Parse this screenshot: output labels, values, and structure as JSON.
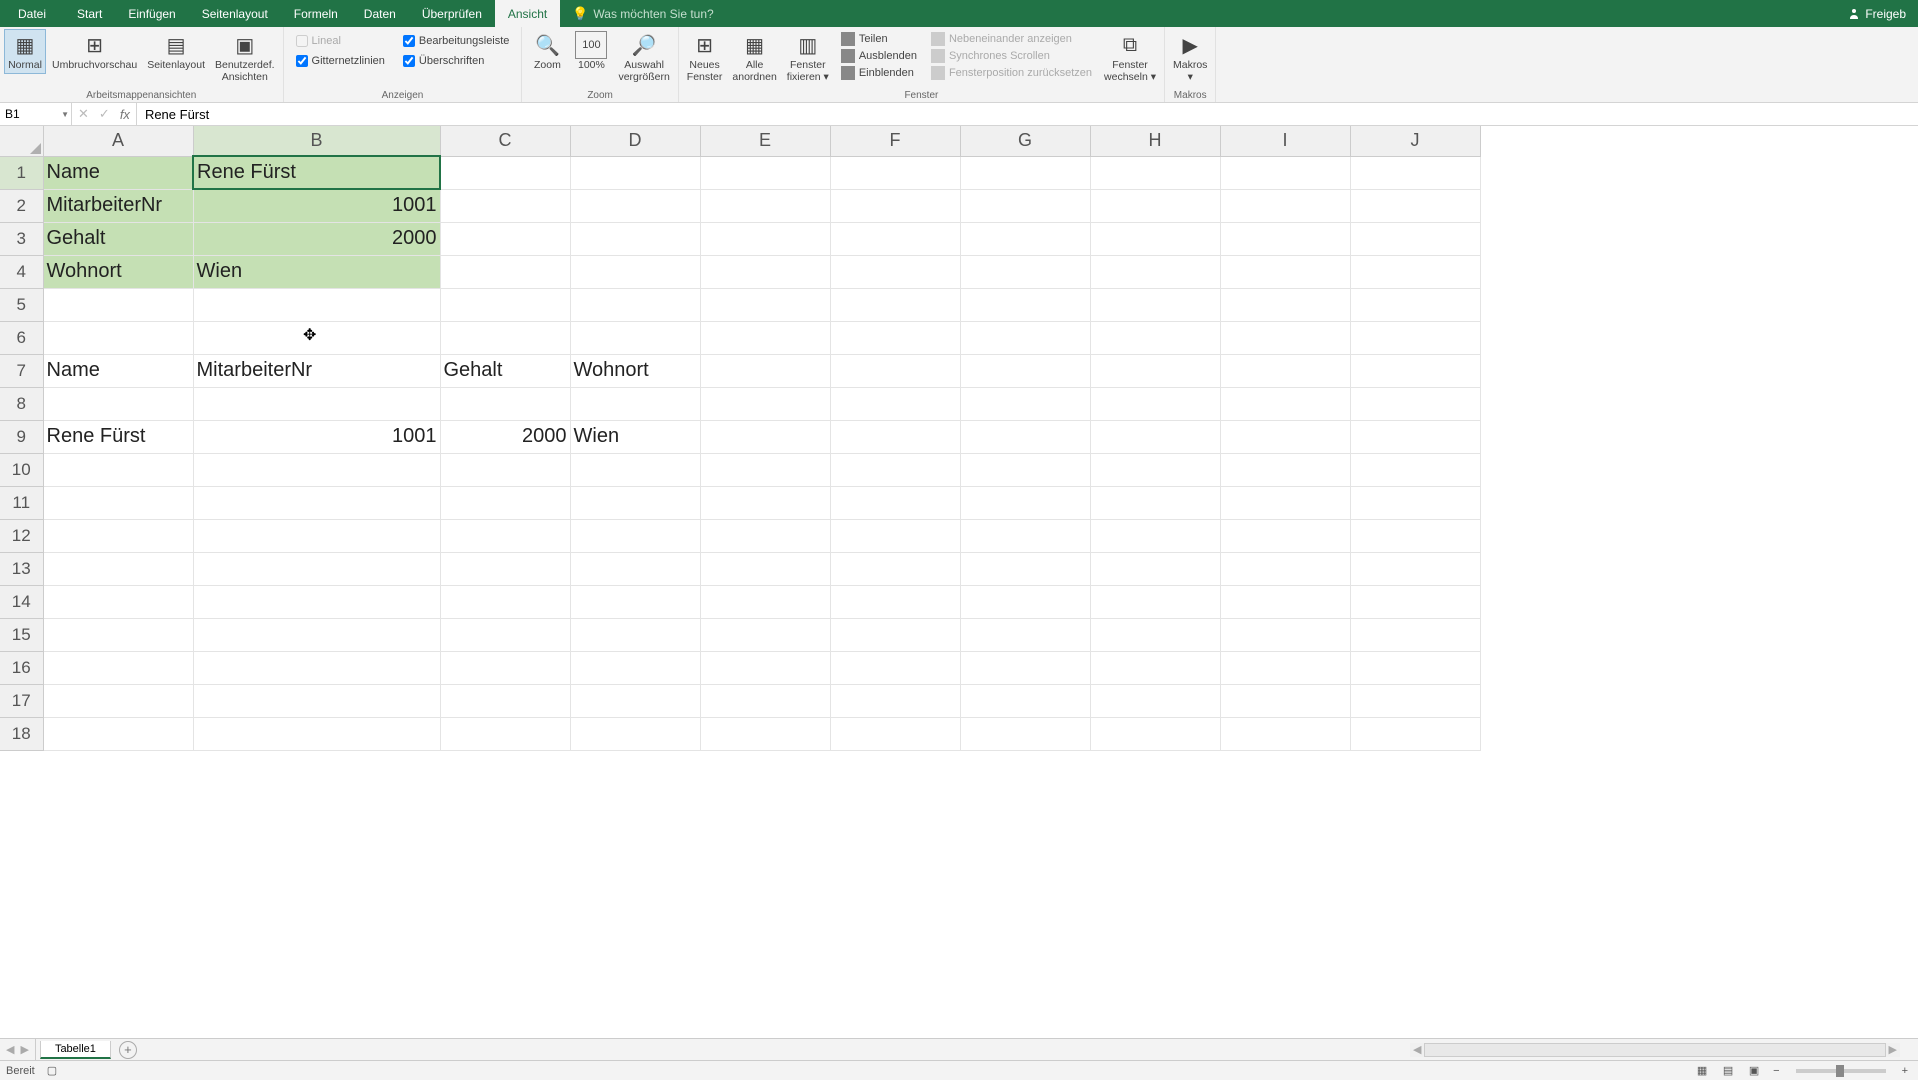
{
  "tabs": {
    "file": "Datei",
    "items": [
      "Start",
      "Einfügen",
      "Seitenlayout",
      "Formeln",
      "Daten",
      "Überprüfen",
      "Ansicht"
    ],
    "active_index": 6,
    "tell_me": "Was möchten Sie tun?",
    "share": "Freigeb"
  },
  "ribbon": {
    "group_views": {
      "label": "Arbeitsmappenansichten",
      "normal": "Normal",
      "page_break": "Umbruchvorschau",
      "page_layout": "Seitenlayout",
      "custom_views": "Benutzerdef.\nAnsichten"
    },
    "group_show": {
      "label": "Anzeigen",
      "ruler": "Lineal",
      "formula_bar": "Bearbeitungsleiste",
      "gridlines": "Gitternetzlinien",
      "headings": "Überschriften"
    },
    "group_zoom": {
      "label": "Zoom",
      "zoom": "Zoom",
      "hundred": "100%",
      "selection": "Auswahl\nvergrößern"
    },
    "group_window": {
      "label": "Fenster",
      "new_window": "Neues\nFenster",
      "arrange_all": "Alle\nanordnen",
      "freeze": "Fenster\nfixieren ▾",
      "split": "Teilen",
      "hide": "Ausblenden",
      "unhide": "Einblenden",
      "side_by_side": "Nebeneinander anzeigen",
      "sync_scroll": "Synchrones Scrollen",
      "reset_pos": "Fensterposition zurücksetzen",
      "switch": "Fenster\nwechseln ▾"
    },
    "group_macros": {
      "label": "Makros",
      "macros": "Makros\n▾"
    }
  },
  "formula_bar": {
    "name_box": "B1",
    "formula": "Rene Fürst"
  },
  "columns": [
    "A",
    "B",
    "C",
    "D",
    "E",
    "F",
    "G",
    "H",
    "I",
    "J"
  ],
  "rows": [
    1,
    2,
    3,
    4,
    5,
    6,
    7,
    8,
    9,
    10,
    11,
    12,
    13,
    14,
    15,
    16,
    17,
    18
  ],
  "active_col": "B",
  "active_row": 1,
  "cells": {
    "A1": "Name",
    "B1": "Rene Fürst",
    "A2": "MitarbeiterNr",
    "B2": "1001",
    "A3": "Gehalt",
    "B3": "2000",
    "A4": "Wohnort",
    "B4": "Wien",
    "A7": "Name",
    "B7": "MitarbeiterNr",
    "C7": "Gehalt",
    "D7": "Wohnort",
    "A9": "Rene Fürst",
    "B9": "1001",
    "C9": "2000",
    "D9": "Wien"
  },
  "sheet": {
    "name": "Tabelle1"
  },
  "status": {
    "ready": "Bereit"
  }
}
